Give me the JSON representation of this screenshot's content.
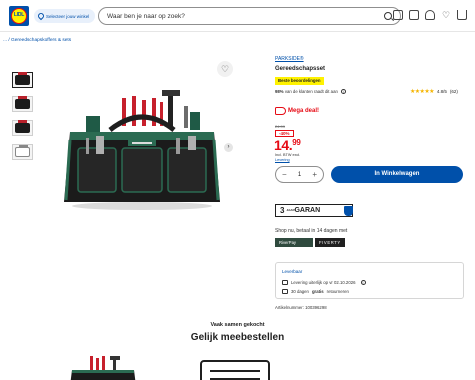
{
  "header": {
    "logo_text": "LIDL",
    "store_selector_label": "Selecteer jouw winkel",
    "search_placeholder": "Waar ben je naar op zoek?",
    "icons": [
      "brochure-icon",
      "store-icon",
      "user-icon",
      "heart-icon",
      "cart-icon"
    ]
  },
  "breadcrumb": {
    "text": "... / Gereedschapskoffers & sets"
  },
  "gallery": {
    "thumbnails": [
      "thumb-1",
      "thumb-2",
      "thumb-3",
      "thumb-4"
    ],
    "active_index": 0
  },
  "product": {
    "brand": "PARKSIDE®",
    "title": "Gereedschapsset",
    "badge": "Beste beoordelingen",
    "satisfaction_pct": "98%",
    "satisfaction_text": "van de klanten raadt dit aan",
    "rating_text": "4.8/5",
    "rating_count": "(62)",
    "rating_value": 4.8,
    "promo_label": "Mega deal!",
    "old_price": "24.99",
    "discount": "-40%",
    "price_whole": "14.",
    "price_cents": "99",
    "vat_text": "Incl. BTW excl.",
    "delivery_link": "Levering",
    "quantity": "1",
    "qty_minus": "−",
    "qty_plus": "+",
    "add_to_cart": "In Winkelwagen"
  },
  "warranty": {
    "years": "3",
    "small": "JAAR",
    "label": "GARAN"
  },
  "payment": {
    "text": "Shop nu, betaal in 14 dagen met",
    "logos": [
      "RiverPay",
      "FIVERTY"
    ]
  },
  "delivery": {
    "label": "Leverbaar",
    "line1": "Levering uiterlijk op vr 02.10.2026",
    "line2_prefix": "30 dagen",
    "line2_bold": "gratis",
    "line2_suffix": "retourneren"
  },
  "article_number": "Artikelnummer: 100396298",
  "bought_together": {
    "subtitle": "Vaak samen gekocht",
    "title": "Gelijk meebestellen"
  },
  "colors": {
    "brand_blue": "#0050aa",
    "accent_yellow": "#fff200",
    "sale_red": "#e60a14"
  }
}
